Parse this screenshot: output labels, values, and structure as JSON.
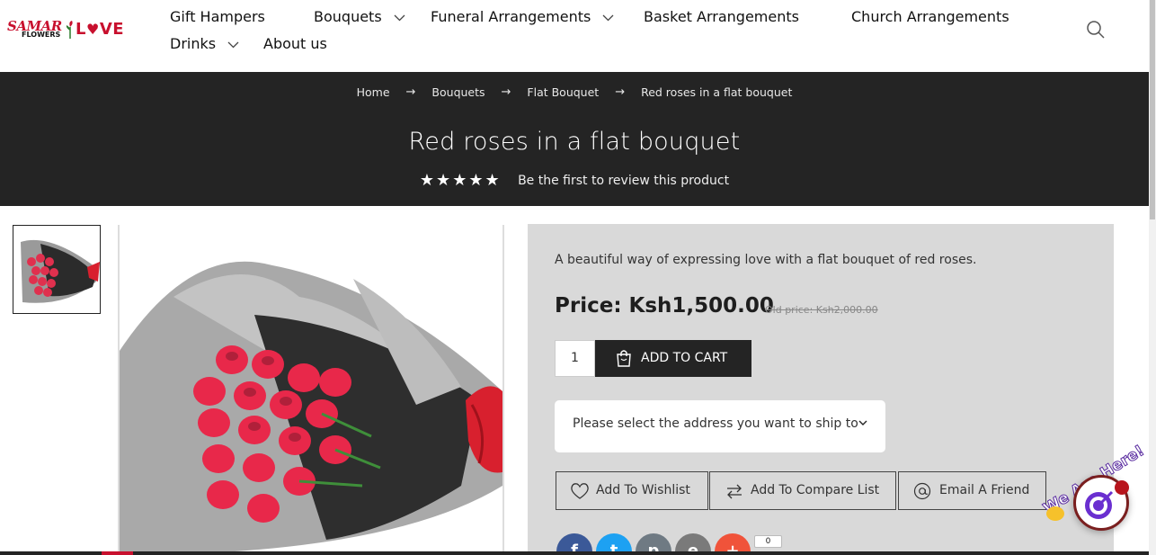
{
  "logo": {
    "word1": "SAMAR",
    "word2": "FLOWERS",
    "word3": "LVE"
  },
  "nav": {
    "items": [
      {
        "label": "Gift Hampers",
        "has_dropdown": false
      },
      {
        "label": "Bouquets",
        "has_dropdown": true
      },
      {
        "label": "Funeral Arrangements",
        "has_dropdown": true
      },
      {
        "label": "Basket Arrangements",
        "has_dropdown": false
      },
      {
        "label": "Church Arrangements",
        "has_dropdown": false
      },
      {
        "label": "Drinks",
        "has_dropdown": true
      },
      {
        "label": "About us",
        "has_dropdown": false
      }
    ],
    "search_icon": "search-icon"
  },
  "breadcrumb": {
    "items": [
      "Home",
      "Bouquets",
      "Flat Bouquet",
      "Red roses in a flat bouquet"
    ],
    "separator": "→"
  },
  "product": {
    "title": "Red roses in a flat bouquet",
    "stars": "★★★★★",
    "review_text": "Be the first to review this product",
    "short_description": "A beautiful way of expressing love with a flat bouquet of red roses.",
    "price": "Price: Ksh1,500.00",
    "old_price": "Old price: Ksh2,000.00",
    "quantity": "1",
    "add_to_cart": "ADD TO CART",
    "ship_placeholder": "Please select the address you want to ship to",
    "actions": {
      "wishlist": "Add To Wishlist",
      "compare": "Add To Compare List",
      "email": "Email A Friend"
    },
    "share": {
      "facebook": "f",
      "twitter": "t",
      "print": "p",
      "email": "e",
      "more": "+",
      "count": "0"
    }
  },
  "chat": {
    "label": "We Are Here!"
  },
  "colors": {
    "banner_bg": "#242424",
    "brand_red": "#c8102e",
    "panel_bg": "#d9d9d9",
    "facebook": "#3b5998",
    "twitter": "#1da1f2",
    "print": "#6f7a83",
    "email": "#7a7a7a",
    "more": "#f0533a"
  }
}
